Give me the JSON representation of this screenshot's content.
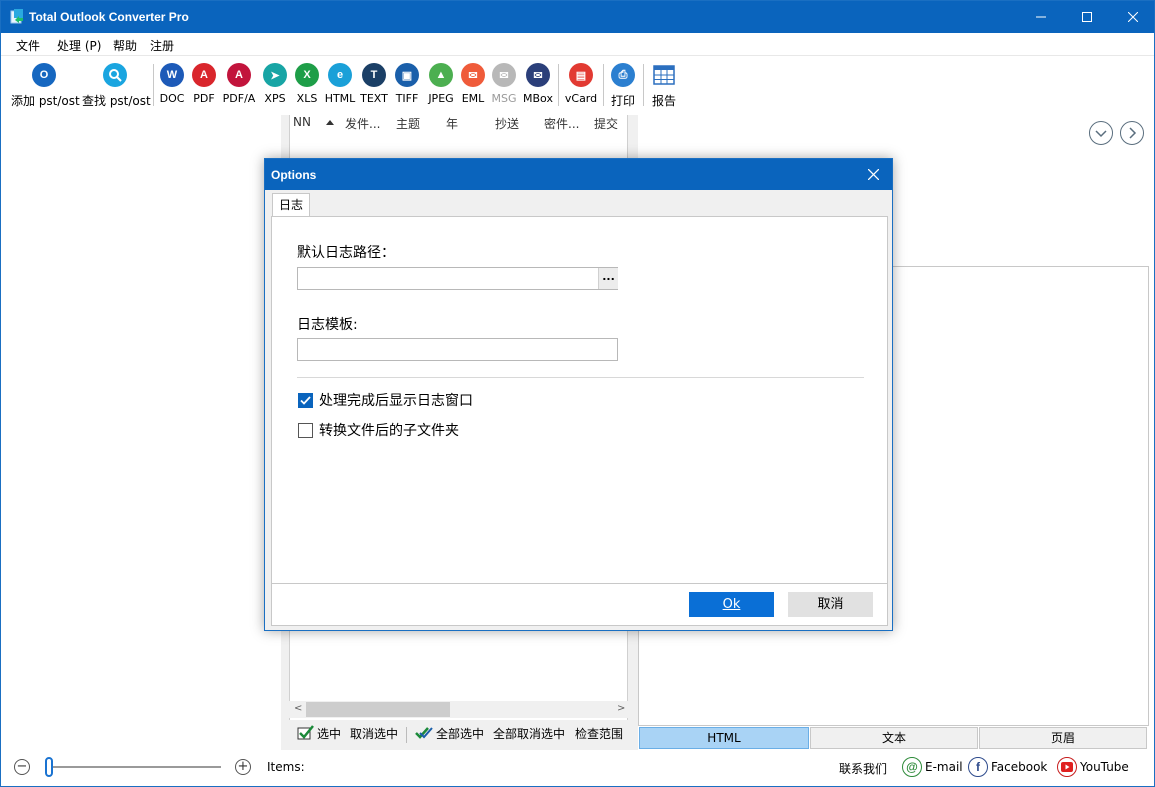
{
  "window": {
    "title": "Total Outlook Converter Pro"
  },
  "menu": {
    "items": [
      "文件",
      "处理 (P)",
      "帮助",
      "注册"
    ]
  },
  "toolbar": {
    "buttons": [
      {
        "label": "添加 pst/ost",
        "icon": "outlook-add-icon",
        "color": "#1667c0",
        "glyph": "O"
      },
      {
        "label": "查找 pst/ost",
        "icon": "search-icon",
        "color": "#1aa5e0",
        "glyph": "🔍"
      },
      {
        "label": "DOC",
        "icon": "word-icon",
        "color": "#1d5ab8",
        "glyph": "W"
      },
      {
        "label": "PDF",
        "icon": "pdf-icon",
        "color": "#d9262c",
        "glyph": "A"
      },
      {
        "label": "PDF/A",
        "icon": "pdfa-icon",
        "color": "#c2143c",
        "glyph": "A"
      },
      {
        "label": "XPS",
        "icon": "xps-icon",
        "color": "#18a5a5",
        "glyph": "➤"
      },
      {
        "label": "XLS",
        "icon": "excel-icon",
        "color": "#1e9e48",
        "glyph": "X"
      },
      {
        "label": "HTML",
        "icon": "html-icon",
        "color": "#1aa0d8",
        "glyph": "e"
      },
      {
        "label": "TEXT",
        "icon": "text-icon",
        "color": "#1b3f66",
        "glyph": "T"
      },
      {
        "label": "TIFF",
        "icon": "tiff-icon",
        "color": "#1a5faa",
        "glyph": "▣"
      },
      {
        "label": "JPEG",
        "icon": "jpeg-icon",
        "color": "#4caf50",
        "glyph": "▲"
      },
      {
        "label": "EML",
        "icon": "eml-icon",
        "color": "#ef5b3a",
        "glyph": "✉"
      },
      {
        "label": "MSG",
        "icon": "msg-icon",
        "color": "#b8b8b8",
        "glyph": "✉"
      },
      {
        "label": "MBox",
        "icon": "mbox-icon",
        "color": "#2b3f7a",
        "glyph": "✉"
      },
      {
        "label": "vCard",
        "icon": "vcard-icon",
        "color": "#e23a32",
        "glyph": "▤"
      },
      {
        "label": "打印",
        "icon": "printer-icon",
        "color": "#2b7fd0",
        "glyph": "⎙"
      },
      {
        "label": "报告",
        "icon": "report-grid-icon",
        "color": "#2b6fbf",
        "glyph": "▦"
      }
    ]
  },
  "list": {
    "columns": [
      "NN",
      "发件...",
      "主题",
      "年",
      "抄送",
      "密件...",
      "提交"
    ],
    "actions": {
      "select": "选中",
      "deselect": "取消选中",
      "select_all": "全部选中",
      "deselect_all": "全部取消选中",
      "check_range": "检查范围"
    }
  },
  "preview": {
    "tabs": [
      "HTML",
      "文本",
      "页眉"
    ],
    "active_tab": "HTML"
  },
  "status": {
    "items_label": "Items:",
    "contact": "联系我们",
    "email": "E-mail",
    "facebook": "Facebook",
    "youtube": "YouTube"
  },
  "dialog": {
    "title": "Options",
    "tab": "日志",
    "log_path_label": "默认日志路径：",
    "log_path_value": "",
    "browse_label": "...",
    "log_template_label": "日志模板:",
    "log_template_value": "",
    "show_log_label": "处理完成后显示日志窗口",
    "show_log_checked": true,
    "subfolder_label": "转换文件后的子文件夹",
    "subfolder_checked": false,
    "ok_label": "Ok",
    "cancel_label": "取消"
  },
  "colors": {
    "accent": "#0a64bd",
    "ok_button": "#0a6fd6",
    "active_tab": "#a9d3f5"
  }
}
